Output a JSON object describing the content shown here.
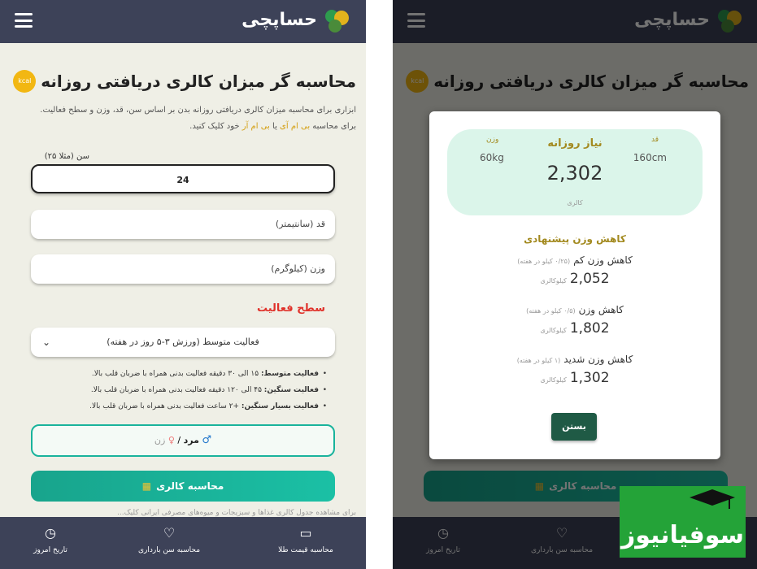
{
  "brand": {
    "name": "حساپچی"
  },
  "title": "محاسبه گر میزان کالری دریافتی روزانه",
  "kcal_badge": "kcal",
  "description": {
    "line1": "ابزاری برای محاسبه میزان کالری دریافتی روزانه بدن بر اساس سن، قد، وزن و سطح فعالیت.",
    "line2_prefix": "برای محاسبه",
    "bmi": "بی ام آی",
    "or": "یا",
    "bmr": "بی ام آر",
    "line2_suffix": "خود کلیک کنید."
  },
  "form": {
    "age_label": "سن (مثلا ۲۵)",
    "age_value": "24",
    "height_placeholder": "قد (سانتیمتر)",
    "weight_placeholder": "وزن (کیلوگرم)",
    "activity_title": "سطح فعالیت",
    "activity_selected": "فعالیت متوسط (ورزش ۳-۵ روز در هفته)",
    "bullets": [
      {
        "bold": "فعالیت متوسط:",
        "text": "۱۵ الی ۳۰ دقیقه فعالیت بدنی همراه با ضربان قلب بالا."
      },
      {
        "bold": "فعالیت سنگین:",
        "text": "۴۵ الی ۱۲۰ دقیقه فعالیت بدنی همراه با ضربان قلب بالا."
      },
      {
        "bold": "فعالیت بسیار سنگین:",
        "text": "+۲ ساعت فعالیت بدنی همراه با ضربان قلب بالا."
      }
    ],
    "gender_male": "مرد",
    "gender_sep": "/",
    "gender_female": "زن",
    "calc_button": "محاسبه کالری",
    "footnote": "برای مشاهده جدول کالری غذاها و سبزیجات و میوه‌های مصرفی ایرانی کلیک..."
  },
  "bottom_nav": [
    {
      "label": "تاریخ امروز",
      "icon": "calendar-icon"
    },
    {
      "label": "محاسبه سن بارداری",
      "icon": "heart-pulse-icon"
    },
    {
      "label": "محاسبه قیمت طلا",
      "icon": "wallet-icon"
    }
  ],
  "modal": {
    "need_title": "نیاز روزانه",
    "need_value": "2,302",
    "need_unit": "کالری",
    "weight_label": "وزن",
    "weight_value": "60kg",
    "height_label": "قد",
    "height_value": "160cm",
    "suggest_title": "کاهش وزن پیشنهادی",
    "suggestions": [
      {
        "label": "کاهش وزن کم",
        "note": "(۰/۲۵ کیلو در هفته)",
        "value": "2,052",
        "unit": "کیلوکالری"
      },
      {
        "label": "کاهش وزن",
        "note": "(۰/۵ کیلو در هفته)",
        "value": "1,802",
        "unit": "کیلوکالری"
      },
      {
        "label": "کاهش وزن شدید",
        "note": "(۱ کیلو در هفته)",
        "value": "1,302",
        "unit": "کیلوکالری"
      }
    ],
    "close_button": "بستن"
  },
  "watermark": {
    "text": "سوفیانیوز"
  },
  "colors": {
    "bar": "#3d4258",
    "accent": "#1bb39c",
    "gold": "#a38a20",
    "red": "#e0322b",
    "watermark": "#24a338"
  }
}
